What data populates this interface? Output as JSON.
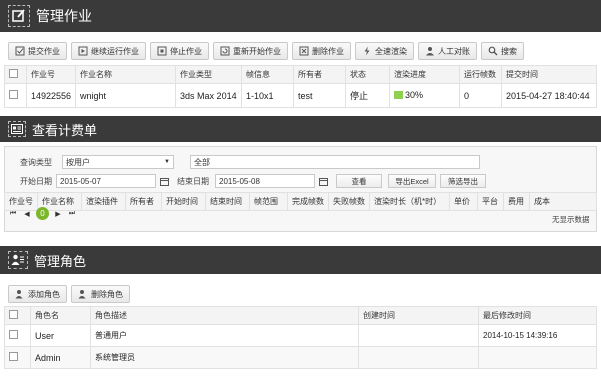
{
  "jobs": {
    "title": "管理作业",
    "toolbar": [
      "提交作业",
      "继续运行作业",
      "停止作业",
      "重新开始作业",
      "删除作业",
      "全速渲染",
      "人工对账",
      "搜索"
    ],
    "columns": [
      "作业号",
      "作业名称",
      "作业类型",
      "帧信息",
      "所有者",
      "状态",
      "渲染进度",
      "运行帧数",
      "提交时间"
    ],
    "rows": [
      {
        "id": "14922556",
        "name": "wnight",
        "type": "3ds Max 2014",
        "frames": "1-10x1",
        "owner": "test",
        "status": "停止",
        "progress": "30%",
        "progress_value": 0.3,
        "running": "0",
        "submitted": "2015-04-27 18:40:44"
      }
    ]
  },
  "billing": {
    "title": "查看计费单",
    "query_type_label": "查询类型",
    "query_type_value": "按用户",
    "query_text": "全部",
    "start_label": "开始日期",
    "start_value": "2015-05-07",
    "end_label": "结束日期",
    "end_value": "2015-05-08",
    "btn_search": "查看",
    "btn_export": "导出Excel",
    "btn_filter_export": "筛选导出",
    "columns": [
      "作业号",
      "作业名称",
      "渲染插件",
      "所有者",
      "开始时间",
      "结束时间",
      "帧范围",
      "完成帧数",
      "失败帧数",
      "渲染时长（机*时）",
      "单价",
      "平台",
      "费用",
      "成本"
    ],
    "page": "0",
    "empty_text": "无显示数据"
  },
  "roles": {
    "title": "管理角色",
    "btn_add": "添加角色",
    "btn_delete": "删除角色",
    "columns": [
      "角色名",
      "角色描述",
      "创建时间",
      "最后修改时间"
    ],
    "rows": [
      {
        "name": "User",
        "desc": "普通用户",
        "created": "",
        "modified": "2014-10-15 14:39:16"
      },
      {
        "name": "Admin",
        "desc": "系统管理员",
        "created": "",
        "modified": ""
      }
    ]
  }
}
